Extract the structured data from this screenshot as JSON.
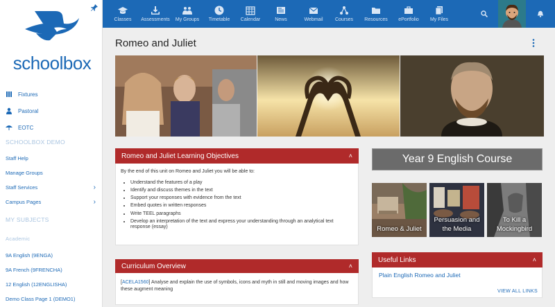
{
  "brand": {
    "name": "schoolbox",
    "color": "#1c69b6"
  },
  "sidebar": {
    "quick": [
      {
        "label": "Fixtures",
        "icon": "fixtures-icon"
      },
      {
        "label": "Pastoral",
        "icon": "person-icon"
      },
      {
        "label": "EOTC",
        "icon": "umbrella-icon"
      }
    ],
    "section1": "SCHOOLBOX DEMO",
    "demo_items": [
      {
        "label": "Staff Help",
        "chevron": false
      },
      {
        "label": "Manage Groups",
        "chevron": false
      },
      {
        "label": "Staff Services",
        "chevron": true
      },
      {
        "label": "Campus Pages",
        "chevron": true
      }
    ],
    "section2": "MY SUBJECTS",
    "subsection": "Academic",
    "subjects": [
      {
        "label": "9A English (9ENGA)"
      },
      {
        "label": "9A French (9FRENCHA)"
      },
      {
        "label": "12 English (12ENGLISHA)"
      },
      {
        "label": "Demo Class Page 1 (DEMO1)"
      }
    ]
  },
  "topnav": [
    {
      "label": "Classes",
      "icon": "mortarboard-icon"
    },
    {
      "label": "Assessments",
      "icon": "download-tray-icon"
    },
    {
      "label": "My Groups",
      "icon": "group-icon"
    },
    {
      "label": "Timetable",
      "icon": "clock-icon"
    },
    {
      "label": "Calendar",
      "icon": "calendar-icon"
    },
    {
      "label": "News",
      "icon": "newspaper-icon"
    },
    {
      "label": "Webmail",
      "icon": "envelope-icon"
    },
    {
      "label": "Courses",
      "icon": "network-icon"
    },
    {
      "label": "Resources",
      "icon": "folder-icon"
    },
    {
      "label": "ePortfolio",
      "icon": "briefcase-icon"
    },
    {
      "label": "My Files",
      "icon": "files-icon"
    }
  ],
  "page": {
    "title": "Romeo and Juliet"
  },
  "objectives": {
    "title": "Romeo and Juliet Learning Objectives",
    "intro": "By the end of this unit on Romeo and Juliet you will be able to:",
    "items": [
      "Understand the features of a play",
      "Identify and discuss themes in the text",
      "Support your responses with evidence from the text",
      "Embed quotes in written responses",
      "Write TEEL paragraphs",
      "Develop an interpretation of the text and express your understanding through an analytical text response (essay)"
    ]
  },
  "curriculum": {
    "title": "Curriculum Overview",
    "code": "ACELA1560",
    "text": " Analyse and explain the use of symbols, icons and myth in still and moving images and how these augment meaning"
  },
  "course": {
    "banner": "Year 9 English Course",
    "tiles": [
      {
        "label": "Romeo & Juliet"
      },
      {
        "label": "Persuasion and the Media"
      },
      {
        "label": "To Kill a Mockingbird"
      }
    ]
  },
  "links": {
    "title": "Useful Links",
    "items": [
      {
        "label": "Plain English Romeo and Juliet"
      }
    ],
    "view_all": "VIEW ALL LINKS"
  },
  "colors": {
    "topbar": "#1c69b6",
    "panel_header": "#b02a2a",
    "banner_grey": "#6b6b6b"
  }
}
